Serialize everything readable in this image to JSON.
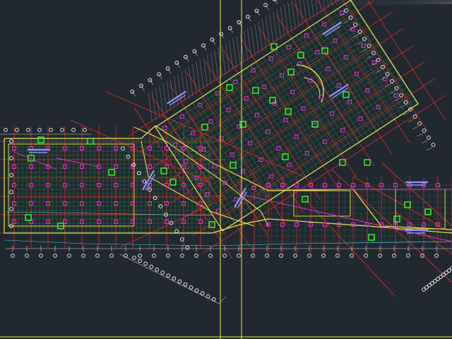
{
  "canvas": {
    "background": "#212830",
    "colors": {
      "grid": "#2fd65a",
      "outline": "#e8e84a",
      "axis": "#e02a2a",
      "column": "#ee2fd0",
      "pile": "#34ff2a",
      "hatch": "#cfcfcf",
      "annotation": "#8f95ff",
      "crosshair": "#e6ee3a",
      "dimension": "#ffffff",
      "detail": "#3fd2ff"
    }
  },
  "viewport": {
    "crosshair": "crosshair-cursor",
    "vertical_guides": 2,
    "horizontal_guides": 1
  },
  "drawing": {
    "type": "foundation-plan",
    "wings": [
      "west-wing",
      "diagonal-wing",
      "south-wing"
    ],
    "marker_icon": "axis-bubble-icon"
  }
}
